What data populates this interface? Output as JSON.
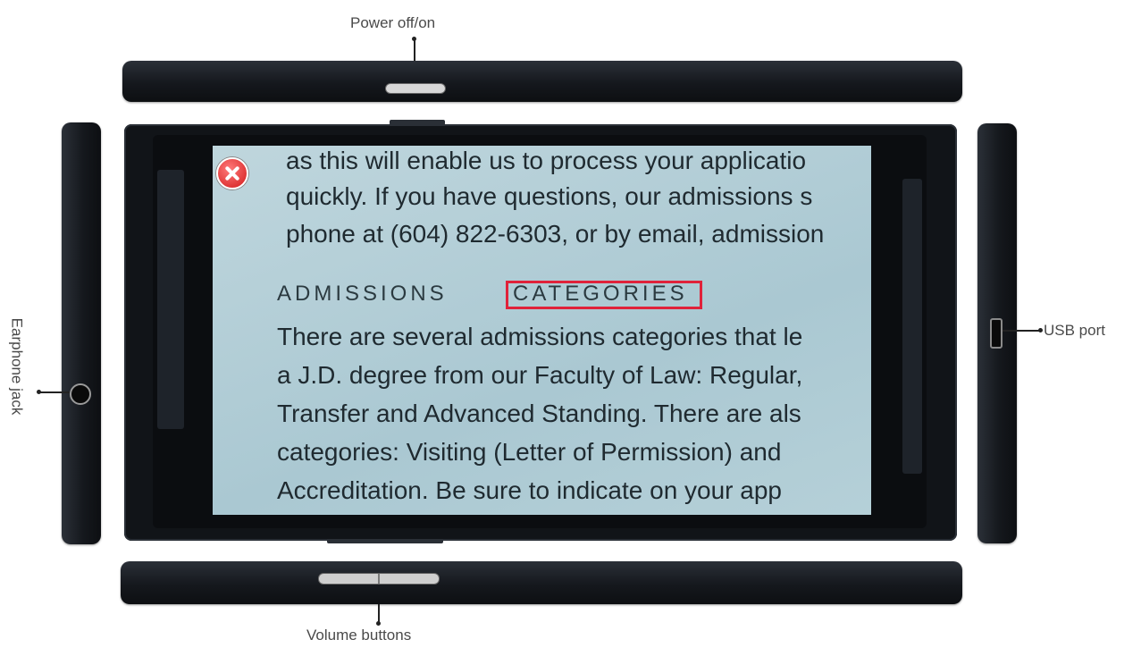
{
  "labels": {
    "power": "Power off/on",
    "volume": "Volume buttons",
    "earphone": "Earphone jack",
    "usb": "USB port"
  },
  "screen_text": {
    "lines_top": [
      "as this will enable us to process your applicatio",
      "quickly. If you have questions, our admissions s",
      "phone at (604) 822-6303, or by email, admission"
    ],
    "heading_word1": "ADMISSIONS",
    "heading_word2": "CATEGORIES",
    "lines_bottom": [
      "There are several admissions categories that le",
      "a J.D. degree from our Faculty of Law: Regular,",
      "Transfer and Advanced Standing. There are als",
      "categories: Visiting (Letter of Permission) and",
      "Accreditation. Be sure to indicate on your app"
    ]
  },
  "colors": {
    "highlight": "#e0223a",
    "screen": "#b5d0d8",
    "device": "#15181d"
  }
}
